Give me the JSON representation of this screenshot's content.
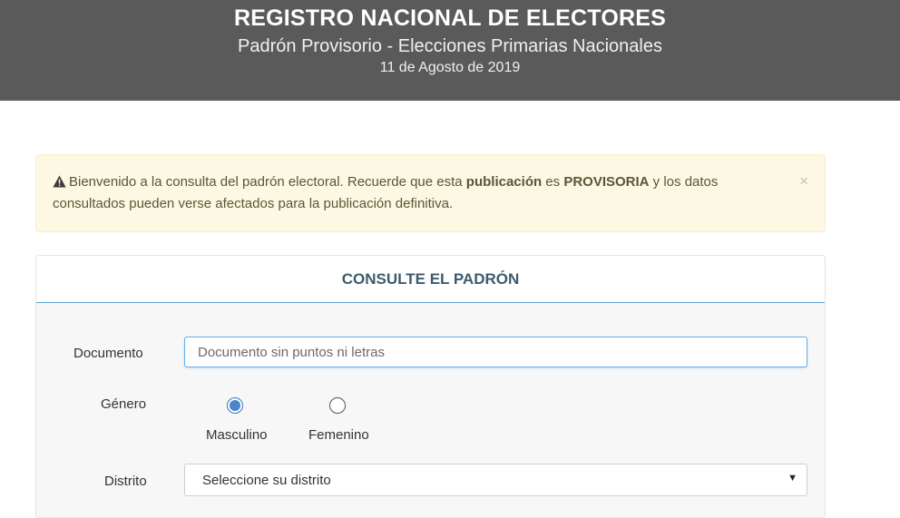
{
  "header": {
    "title": "REGISTRO NACIONAL DE ELECTORES",
    "subtitle": "Padrón Provisorio - Elecciones Primarias Nacionales",
    "date": "11 de Agosto de 2019"
  },
  "alert": {
    "text_1": "Bienvenido a la consulta del padrón electoral. Recuerde que esta ",
    "bold_1": "publicación",
    "text_2": " es ",
    "bold_2": "PROVISORIA",
    "text_3": " y los datos consultados pueden verse afectados para la publicación definitiva.",
    "close_label": "×",
    "icon": "warning-icon"
  },
  "form": {
    "title": "CONSULTE EL PADRÓN",
    "documento_label": "Documento",
    "documento_placeholder": "Documento sin puntos ni letras",
    "documento_value": "",
    "genero_label": "Género",
    "genero_options": [
      {
        "label": "Masculino",
        "selected": true
      },
      {
        "label": "Femenino",
        "selected": false
      }
    ],
    "distrito_label": "Distrito",
    "distrito_selected": "Seleccione su distrito"
  },
  "colors": {
    "header_bg": "#5a5a5a",
    "alert_bg": "#fcf8e3",
    "accent": "#4a86cc",
    "panel_title": "#3e5b6e"
  }
}
